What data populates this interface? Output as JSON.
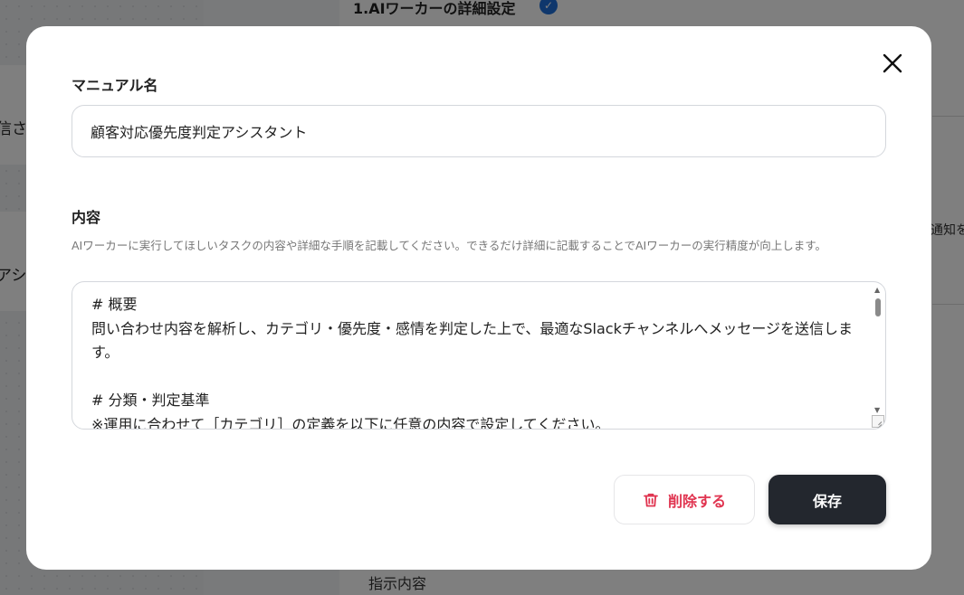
{
  "background": {
    "step_title": "1.AIワーカーの詳細設定",
    "left_text_1": "信さ",
    "left_text_2": "アシ",
    "right_text": "通知を",
    "bottom_text": "指示内容"
  },
  "modal": {
    "name_label": "マニュアル名",
    "name_value": "顧客対応優先度判定アシスタント",
    "content_label": "内容",
    "help_text": "AIワーカーに実行してほしいタスクの内容や詳細な手順を記載してください。できるだけ詳細に記載することでAIワーカーの実行精度が向上します。",
    "content_value": "# 概要\n問い合わせ内容を解析し、カテゴリ・優先度・感情を判定した上で、最適なSlackチャンネルへメッセージを送信します。\n\n# 分類・判定基準\n※運用に合わせて［カテゴリ］の定義を以下に任意の内容で設定してください。",
    "delete_label": "削除する",
    "save_label": "保存"
  },
  "colors": {
    "accent_delete": "#e0334f",
    "save_bg": "#23272e",
    "check_badge": "#1e6fd9"
  },
  "icons": {
    "close": "close-icon",
    "delete": "trash-icon",
    "check": "check-circle-icon"
  }
}
